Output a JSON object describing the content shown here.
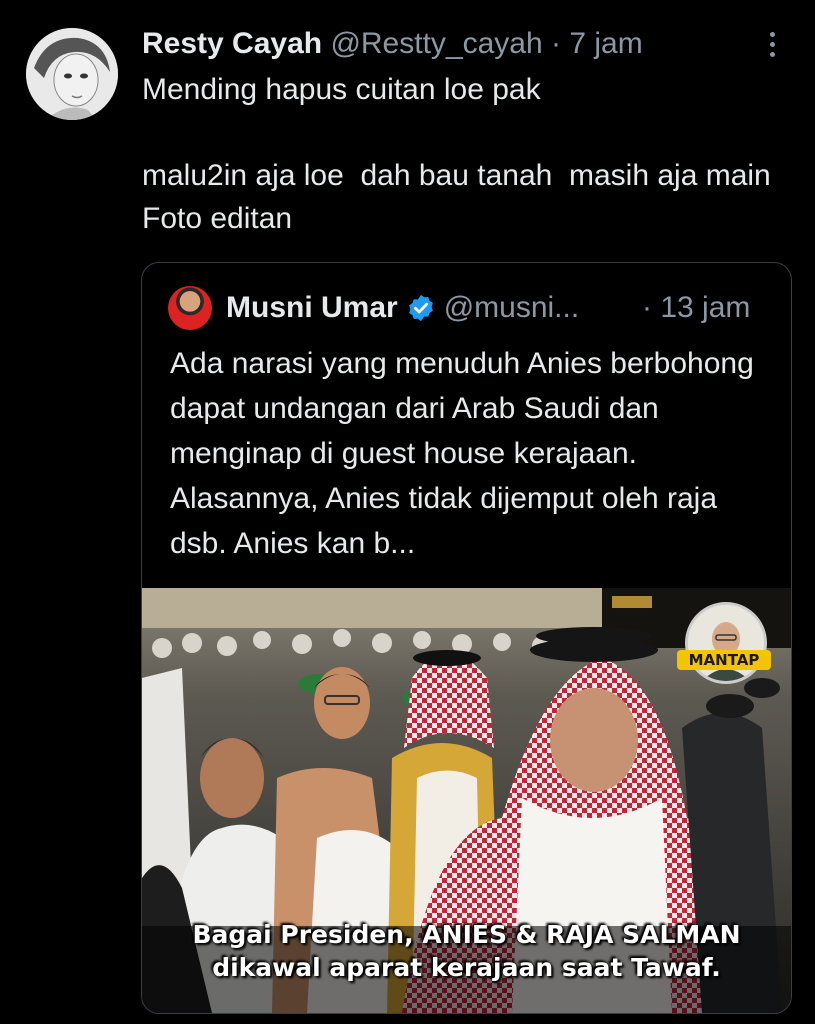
{
  "reply": {
    "author_name": "Resty Cayah",
    "author_handle": "@Restty_cayah",
    "separator": "·",
    "time": "7 jam",
    "text_line1": "Mending hapus cuitan loe pak",
    "text_line2": "malu2in aja loe  dah bau tanah  masih aja main  Foto editan",
    "more_icon": "more-vertical-icon"
  },
  "quoted": {
    "author_name": "Musni Umar",
    "author_handle": "@musni...",
    "separator": "·",
    "time": "13 jam",
    "verified_icon": "verified-badge-icon",
    "text": "Ada narasi yang menuduh Anies berbohong  dapat undangan dari Arab Saudi dan menginap di guest house kerajaan.  Alasannya,  Anies tidak dijemput oleh raja dsb.  Anies kan b...",
    "image": {
      "badge_label": "MANTAP",
      "caption_line1": "Bagai Presiden, ANIES & RAJA SALMAN",
      "caption_line2": "dikawal aparat kerajaan saat Tawaf."
    }
  },
  "colors": {
    "background": "#000000",
    "primary_text": "#e7e9ea",
    "secondary_text": "#8b98a5",
    "verified_blue": "#1d9bf0",
    "badge_yellow": "#f5c400"
  }
}
